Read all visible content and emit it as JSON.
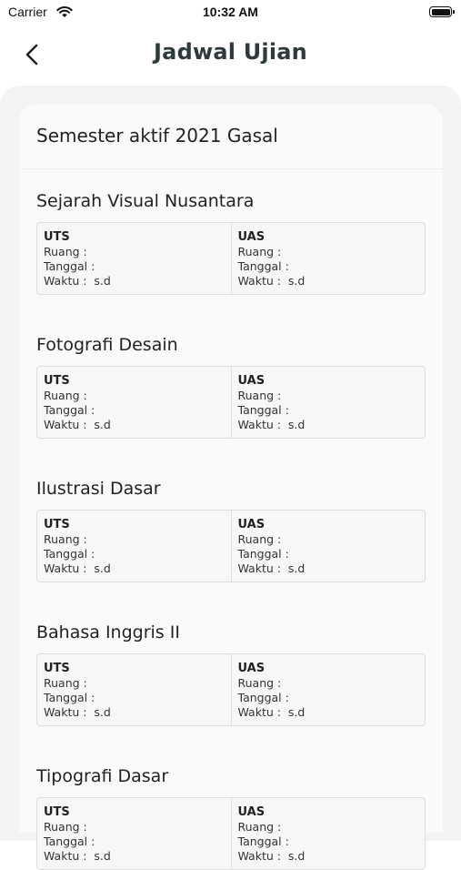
{
  "status_bar": {
    "carrier": "Carrier",
    "time": "10:32 AM"
  },
  "header": {
    "title": "Jadwal Ujian"
  },
  "semester": {
    "title": "Semester aktif 2021 Gasal"
  },
  "courses": [
    {
      "name": "Sejarah Visual Nusantara",
      "uts": {
        "type": "UTS",
        "ruang": "Ruang :",
        "tanggal": "Tanggal :",
        "waktu": "Waktu :  s.d"
      },
      "uas": {
        "type": "UAS",
        "ruang": "Ruang :",
        "tanggal": "Tanggal :",
        "waktu": "Waktu :  s.d"
      }
    },
    {
      "name": "Fotografi Desain",
      "uts": {
        "type": "UTS",
        "ruang": "Ruang :",
        "tanggal": "Tanggal :",
        "waktu": "Waktu :  s.d"
      },
      "uas": {
        "type": "UAS",
        "ruang": "Ruang :",
        "tanggal": "Tanggal :",
        "waktu": "Waktu :  s.d"
      }
    },
    {
      "name": "Ilustrasi Dasar",
      "uts": {
        "type": "UTS",
        "ruang": "Ruang :",
        "tanggal": "Tanggal :",
        "waktu": "Waktu :  s.d"
      },
      "uas": {
        "type": "UAS",
        "ruang": "Ruang :",
        "tanggal": "Tanggal :",
        "waktu": "Waktu :  s.d"
      }
    },
    {
      "name": "Bahasa Inggris II",
      "uts": {
        "type": "UTS",
        "ruang": "Ruang :",
        "tanggal": "Tanggal :",
        "waktu": "Waktu :  s.d"
      },
      "uas": {
        "type": "UAS",
        "ruang": "Ruang :",
        "tanggal": "Tanggal :",
        "waktu": "Waktu :  s.d"
      }
    },
    {
      "name": "Tipografi Dasar",
      "uts": {
        "type": "UTS",
        "ruang": "Ruang :",
        "tanggal": "Tanggal :",
        "waktu": "Waktu :  s.d"
      },
      "uas": {
        "type": "UAS",
        "ruang": "Ruang :",
        "tanggal": "Tanggal :",
        "waktu": "Waktu :  s.d"
      }
    }
  ],
  "icons": {
    "back": "chevron-left-icon",
    "wifi": "wifi-icon",
    "battery": "battery-icon"
  },
  "colors": {
    "title": "#2e3b3c",
    "panel": "#f3f3f3",
    "card": "#fafafa"
  }
}
